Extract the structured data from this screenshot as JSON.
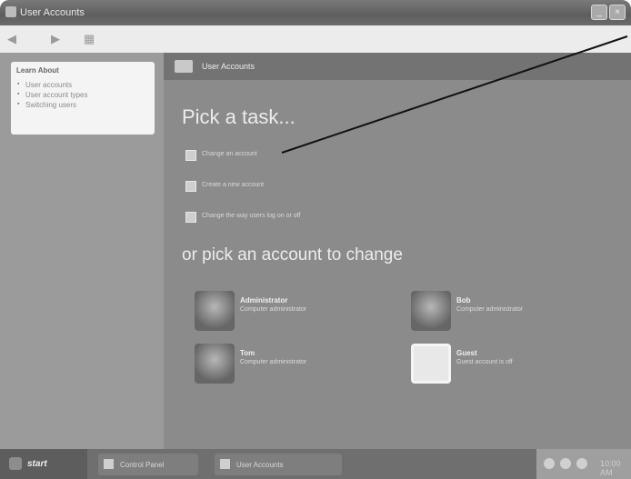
{
  "window": {
    "title": "User Accounts",
    "buttons": {
      "minimize": "_",
      "close": "×"
    }
  },
  "toolbar": {
    "back_icon": "back-arrow-icon",
    "forward_icon": "forward-arrow-icon",
    "view_icon": "folders-view-icon"
  },
  "sidebar": {
    "learn_about": {
      "heading": "Learn About",
      "items": [
        {
          "label": "User accounts"
        },
        {
          "label": "User account types"
        },
        {
          "label": "Switching users"
        }
      ]
    }
  },
  "main": {
    "header": {
      "title": "User Accounts",
      "icon": "user-accounts-icon"
    },
    "pick_task_title": "Pick a task...",
    "tasks": [
      {
        "label": "Change an account"
      },
      {
        "label": "Create a new account"
      },
      {
        "label": "Change the way users log on or off"
      }
    ],
    "pick_account_title": "or pick an account to change",
    "accounts": [
      {
        "name": "Administrator",
        "desc": "Computer administrator",
        "picture": "user-photo"
      },
      {
        "name": "Bob",
        "desc": "Computer administrator",
        "picture": "user-photo"
      },
      {
        "name": "Tom",
        "desc": "Computer administrator",
        "picture": "user-photo"
      },
      {
        "name": "Guest",
        "desc": "Guest account is off",
        "picture": "guest-photo"
      }
    ]
  },
  "taskbar": {
    "start": "start",
    "tasks": [
      {
        "label": "Control Panel"
      },
      {
        "label": "User Accounts"
      }
    ],
    "clock": "10:00 AM"
  },
  "colors": {
    "window_bg": "#8b8b8b",
    "title_text": "#ececec",
    "learn_panel": "#f4f4f4",
    "callout_line": "#111111"
  }
}
